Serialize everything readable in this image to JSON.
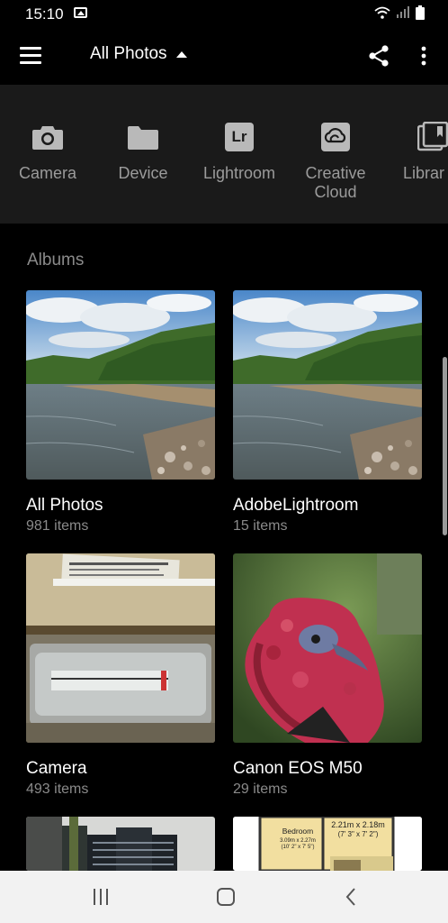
{
  "status_bar": {
    "time": "15:10"
  },
  "app_bar": {
    "title": "All Photos"
  },
  "sources": [
    {
      "label": "Camera",
      "icon": "camera-icon"
    },
    {
      "label": "Device",
      "icon": "folder-icon"
    },
    {
      "label": "Lightroom",
      "icon": "lightroom-icon",
      "badge_text": "Lr"
    },
    {
      "label": "Creative\nCloud",
      "icon": "creative-cloud-icon"
    },
    {
      "label": "Librar",
      "icon": "library-icon"
    }
  ],
  "albums_heading": "Albums",
  "albums": [
    {
      "name": "All Photos",
      "count": "981 items",
      "thumbnail": "lake-landscape"
    },
    {
      "name": "AdobeLightroom",
      "count": "15 items",
      "thumbnail": "lake-landscape"
    },
    {
      "name": "Camera",
      "count": "493 items",
      "thumbnail": "meter-gauge"
    },
    {
      "name": "Canon EOS M50",
      "count": "29 items",
      "thumbnail": "turkey-head"
    },
    {
      "name": "",
      "count": "",
      "thumbnail": "city-buildings"
    },
    {
      "name": "",
      "count": "",
      "thumbnail": "floor-plan",
      "plan_text": {
        "room": "Bedroom",
        "room_dims": "3.09m x 2.27m",
        "room_dims_imperial": "(10' 2\" x 7' 5\")",
        "other_dims": "2.21m x 2.18m",
        "other_dims_imperial": "(7' 3\" x 7' 2\")"
      }
    }
  ],
  "colors": {
    "background": "#000000",
    "sources_bg": "#1a1a1a",
    "muted_text": "#8a8a8a",
    "nav_bg": "#f2f2f2"
  }
}
